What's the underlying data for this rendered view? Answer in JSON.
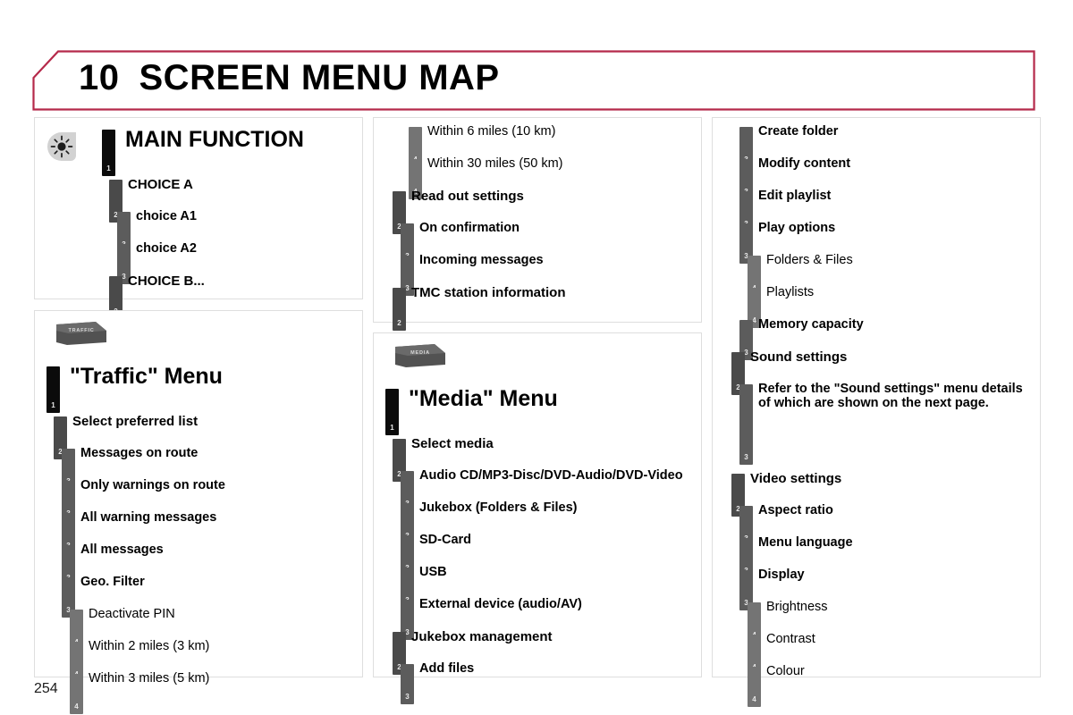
{
  "header": {
    "chapter_number": "10",
    "title": "SCREEN MENU MAP",
    "border_color": "#b5294a"
  },
  "page_number": "254",
  "colors": {
    "level1_bar": "#0b0b0b",
    "level2_bar": "#4a4a4a",
    "level3_bar": "#5c5c5c",
    "level4_bar": "#747474",
    "panel_border": "#dedede",
    "page_background": "#ffffff"
  },
  "panels": [
    {
      "id": "legend",
      "name": "main-function-legend",
      "icon": "sun-brightness-icon",
      "rows": [
        {
          "level": 1,
          "num": "1",
          "label": "MAIN FUNCTION"
        },
        {
          "level": 2,
          "num": "2",
          "label": "CHOICE A"
        },
        {
          "level": 3,
          "num": "3",
          "label": "choice A1"
        },
        {
          "level": 3,
          "num": "3",
          "label": "choice A2"
        },
        {
          "level": 2,
          "num": "2",
          "label": "CHOICE B..."
        }
      ]
    },
    {
      "id": "traffic",
      "name": "traffic-menu",
      "device_button": "TRAFFIC",
      "rows": [
        {
          "level": 1,
          "num": "1",
          "label": "\"Traffic\" Menu"
        },
        {
          "level": 2,
          "num": "2",
          "label": "Select preferred list"
        },
        {
          "level": 3,
          "num": "3",
          "label": "Messages on route"
        },
        {
          "level": 3,
          "num": "3",
          "label": "Only warnings on route"
        },
        {
          "level": 3,
          "num": "3",
          "label": "All warning messages"
        },
        {
          "level": 3,
          "num": "3",
          "label": "All messages"
        },
        {
          "level": 3,
          "num": "3",
          "label": "Geo. Filter"
        },
        {
          "level": 4,
          "num": "4",
          "label": "Deactivate PIN"
        },
        {
          "level": 4,
          "num": "4",
          "label": "Within 2 miles (3 km)"
        },
        {
          "level": 4,
          "num": "4",
          "label": "Within 3 miles (5 km)"
        }
      ]
    },
    {
      "id": "traffic-cont",
      "name": "traffic-menu-continued",
      "rows": [
        {
          "level": 4,
          "num": "4",
          "label": "Within 6 miles (10 km)"
        },
        {
          "level": 4,
          "num": "4",
          "label": "Within 30 miles (50 km)"
        },
        {
          "level": 2,
          "num": "2",
          "label": "Read out settings"
        },
        {
          "level": 3,
          "num": "3",
          "label": "On confirmation"
        },
        {
          "level": 3,
          "num": "3",
          "label": "Incoming messages"
        },
        {
          "level": 2,
          "num": "2",
          "label": "TMC station information"
        }
      ]
    },
    {
      "id": "media",
      "name": "media-menu",
      "device_button": "MEDIA",
      "rows": [
        {
          "level": 1,
          "num": "1",
          "label": "\"Media\" Menu"
        },
        {
          "level": 2,
          "num": "2",
          "label": "Select media"
        },
        {
          "level": 3,
          "num": "3",
          "label": "Audio CD/MP3-Disc/DVD-Audio/DVD-Video"
        },
        {
          "level": 3,
          "num": "3",
          "label": "Jukebox (Folders & Files)"
        },
        {
          "level": 3,
          "num": "3",
          "label": "SD-Card"
        },
        {
          "level": 3,
          "num": "3",
          "label": "USB"
        },
        {
          "level": 3,
          "num": "3",
          "label": "External device (audio/AV)"
        },
        {
          "level": 2,
          "num": "2",
          "label": "Jukebox management"
        },
        {
          "level": 3,
          "num": "3",
          "label": "Add files"
        }
      ]
    },
    {
      "id": "media-cont",
      "name": "media-menu-continued",
      "rows": [
        {
          "level": 3,
          "num": "3",
          "label": "Create folder"
        },
        {
          "level": 3,
          "num": "3",
          "label": "Modify content"
        },
        {
          "level": 3,
          "num": "3",
          "label": "Edit playlist"
        },
        {
          "level": 3,
          "num": "3",
          "label": "Play options"
        },
        {
          "level": 4,
          "num": "4",
          "label": "Folders & Files"
        },
        {
          "level": 4,
          "num": "4",
          "label": "Playlists"
        },
        {
          "level": 3,
          "num": "3",
          "label": "Memory capacity"
        },
        {
          "level": 2,
          "num": "2",
          "label": "Sound settings"
        },
        {
          "level": 3,
          "num": "3",
          "label": "Refer to the \"Sound settings\" menu details\nof which are shown on the next page.",
          "tall": true
        },
        {
          "level": 2,
          "num": "2",
          "label": "Video settings"
        },
        {
          "level": 3,
          "num": "3",
          "label": "Aspect ratio"
        },
        {
          "level": 3,
          "num": "3",
          "label": "Menu language"
        },
        {
          "level": 3,
          "num": "3",
          "label": "Display"
        },
        {
          "level": 4,
          "num": "4",
          "label": "Brightness"
        },
        {
          "level": 4,
          "num": "4",
          "label": "Contrast"
        },
        {
          "level": 4,
          "num": "4",
          "label": "Colour"
        }
      ]
    }
  ]
}
